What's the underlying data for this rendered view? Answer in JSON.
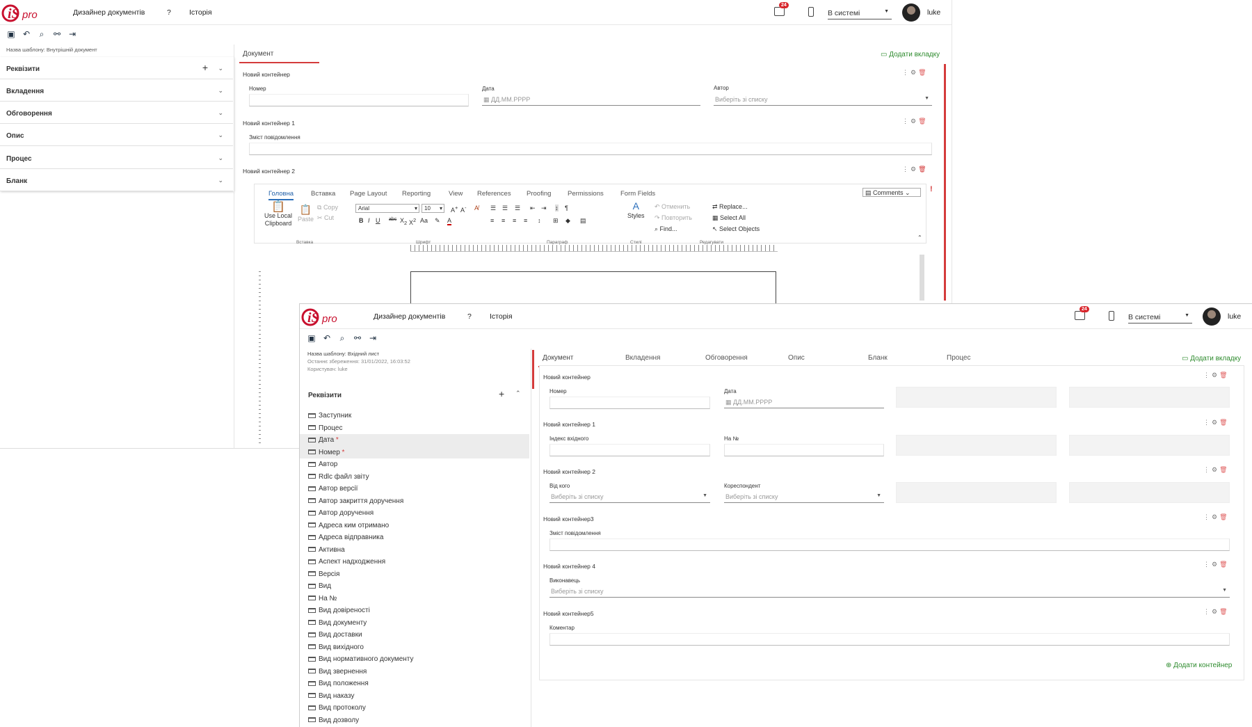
{
  "app": {
    "nav_designer": "Дизайнер документів",
    "nav_help": "?",
    "nav_history": "Історія",
    "notifications_count": "24",
    "status": "В системі",
    "user": "luke",
    "accent_color": "#d43b3b",
    "brand_color": "#c8102e"
  },
  "toolbar_icons": [
    "save-icon",
    "undo-icon",
    "preview-icon",
    "link-icon",
    "exit-icon"
  ],
  "w1": {
    "template_name": "Назва шаблону: Внутрішній документ",
    "accordion": [
      {
        "label": "Реквізити",
        "has_add": true
      },
      {
        "label": "Вкладення"
      },
      {
        "label": "Обговорення"
      },
      {
        "label": "Опис"
      },
      {
        "label": "Процес"
      },
      {
        "label": "Бланк"
      }
    ],
    "tab_document": "Документ",
    "add_tab": "Додати вкладку",
    "c1_title": "Новий контейнер",
    "c1_number_label": "Номер",
    "c1_date_label": "Дата",
    "c1_date_placeholder": "ДД.ММ.РРРР",
    "c1_author_label": "Автор",
    "c1_author_placeholder": "Виберіть зі списку",
    "c2_title": "Новий контейнер 1",
    "c2_message_label": "Зміст повідомлення",
    "c3_title": "Новий контейнер 2",
    "ribbon": {
      "tabs": [
        "Головна",
        "Вставка",
        "Page Layout",
        "Reporting",
        "View",
        "References",
        "Proofing",
        "Permissions",
        "Form Fields"
      ],
      "comments": "Comments",
      "clipboard": "Use Local Clipboard",
      "paste": "Paste",
      "copy": "Copy",
      "cut": "Cut",
      "font": "Arial",
      "size": "10",
      "styles": "Styles",
      "undo": "Отменить",
      "redo": "Повторить",
      "find": "Find...",
      "replace": "Replace...",
      "select_all": "Select All",
      "select_objects": "Select Objects",
      "groups": [
        "Вставка",
        "Шрифт",
        "Параграф",
        "Стилі",
        "Редагувати"
      ]
    }
  },
  "w2": {
    "template_name": "Назва шаблону: Вхідний лист",
    "last_saved": "Останнє збереження: 31/01/2022, 16:03:52",
    "saved_by": "Користувач: luke",
    "requisites": "Реквізити",
    "fields": [
      {
        "label": "Заступник"
      },
      {
        "label": "Процес"
      },
      {
        "label": "Дата",
        "required": true,
        "selected": true
      },
      {
        "label": "Номер",
        "required": true,
        "selected": true
      },
      {
        "label": "Автор"
      },
      {
        "label": "Rdlc файл звіту"
      },
      {
        "label": "Автор версії"
      },
      {
        "label": "Автор закриття доручення"
      },
      {
        "label": "Автор доручення"
      },
      {
        "label": "Адреса ким отримано"
      },
      {
        "label": "Адреса відправника"
      },
      {
        "label": "Активна"
      },
      {
        "label": "Аспект надходження"
      },
      {
        "label": "Версія"
      },
      {
        "label": "Вид"
      },
      {
        "label": "На №"
      },
      {
        "label": "Вид довіреності"
      },
      {
        "label": "Вид документу"
      },
      {
        "label": "Вид доставки"
      },
      {
        "label": "Вид вихідного"
      },
      {
        "label": "Вид нормативного документу"
      },
      {
        "label": "Вид звернення"
      },
      {
        "label": "Вид положення"
      },
      {
        "label": "Вид наказу"
      },
      {
        "label": "Вид протоколу"
      },
      {
        "label": "Вид дозволу"
      }
    ],
    "tabs": [
      "Документ",
      "Вкладення",
      "Обговорення",
      "Опис",
      "Бланк",
      "Процес"
    ],
    "add_tab": "Додати вкладку",
    "containers": {
      "c0": {
        "title": "Новий контейнер",
        "f1": "Номер",
        "f2": "Дата",
        "f2_ph": "ДД.ММ.РРРР"
      },
      "c1": {
        "title": "Новий контейнер 1",
        "f1": "Індекс вхідного",
        "f2": "На №"
      },
      "c2": {
        "title": "Новий контейнер 2",
        "f1": "Від кого",
        "f1_ph": "Виберіть зі списку",
        "f2": "Кореспондент",
        "f2_ph": "Виберіть зі списку"
      },
      "c3": {
        "title": "Новий контейнер3",
        "f1": "Зміст повідомлення"
      },
      "c4": {
        "title": "Новий контейнер 4",
        "f1": "Виконавець",
        "f1_ph": "Виберіть зі списку"
      },
      "c5": {
        "title": "Новий контейнер5",
        "f1": "Коментар"
      }
    },
    "add_container": "Додати контейнер"
  }
}
